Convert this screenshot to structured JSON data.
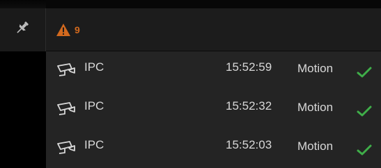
{
  "header": {
    "pin_icon": "pin-icon",
    "alert_icon": "warning-triangle-icon",
    "alert_count": "9",
    "alert_color": "#d2691e"
  },
  "events": [
    {
      "icon": "camera-icon",
      "source": "IPC",
      "time": "15:52:59",
      "type": "Motion",
      "status_icon": "check-icon"
    },
    {
      "icon": "camera-icon",
      "source": "IPC",
      "time": "15:52:32",
      "type": "Motion",
      "status_icon": "check-icon"
    },
    {
      "icon": "camera-icon",
      "source": "IPC",
      "time": "15:52:03",
      "type": "Motion",
      "status_icon": "check-icon"
    }
  ],
  "colors": {
    "check": "#3fae49",
    "text": "#d8d8d8",
    "list_bg": "#242424",
    "header_bg": "#1c1c1c"
  }
}
